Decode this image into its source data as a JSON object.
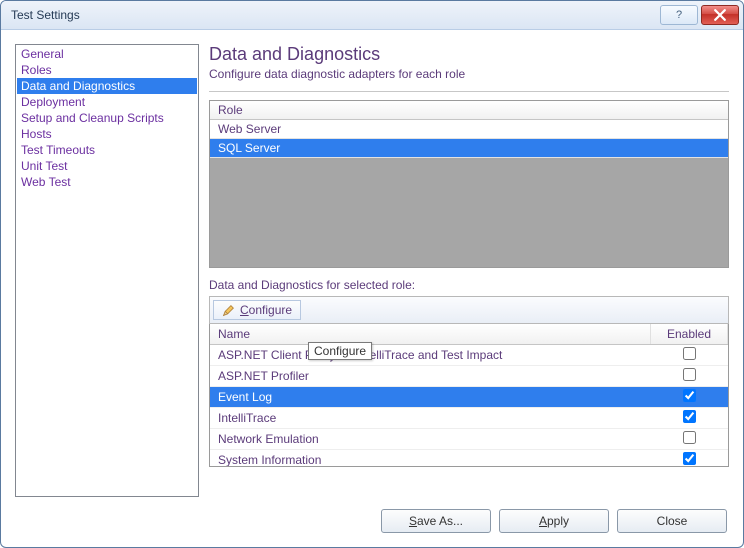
{
  "window": {
    "title": "Test Settings"
  },
  "sidebar": {
    "items": [
      {
        "label": "General",
        "selected": false
      },
      {
        "label": "Roles",
        "selected": false
      },
      {
        "label": "Data and Diagnostics",
        "selected": true
      },
      {
        "label": "Deployment",
        "selected": false
      },
      {
        "label": "Setup and Cleanup Scripts",
        "selected": false
      },
      {
        "label": "Hosts",
        "selected": false
      },
      {
        "label": "Test Timeouts",
        "selected": false
      },
      {
        "label": "Unit Test",
        "selected": false
      },
      {
        "label": "Web Test",
        "selected": false
      }
    ]
  },
  "main": {
    "heading": "Data and Diagnostics",
    "subheading": "Configure data diagnostic adapters for each role",
    "roles_header": "Role",
    "roles": [
      {
        "name": "Web Server",
        "selected": false
      },
      {
        "name": "SQL Server",
        "selected": true
      }
    ],
    "section_label": "Data and Diagnostics for selected role:",
    "configure_label": "Configure",
    "columns": {
      "name": "Name",
      "enabled": "Enabled"
    },
    "tooltip": "Configure",
    "adapters": [
      {
        "name": "ASP.NET Client Proxy for IntelliTrace and Test Impact",
        "enabled": false,
        "selected": false
      },
      {
        "name": "ASP.NET Profiler",
        "enabled": false,
        "selected": false
      },
      {
        "name": "Event Log",
        "enabled": true,
        "selected": true
      },
      {
        "name": "IntelliTrace",
        "enabled": true,
        "selected": false
      },
      {
        "name": "Network Emulation",
        "enabled": false,
        "selected": false
      },
      {
        "name": "System Information",
        "enabled": true,
        "selected": false
      }
    ]
  },
  "footer": {
    "save_as": "Save As...",
    "apply": "Apply",
    "close": "Close"
  }
}
